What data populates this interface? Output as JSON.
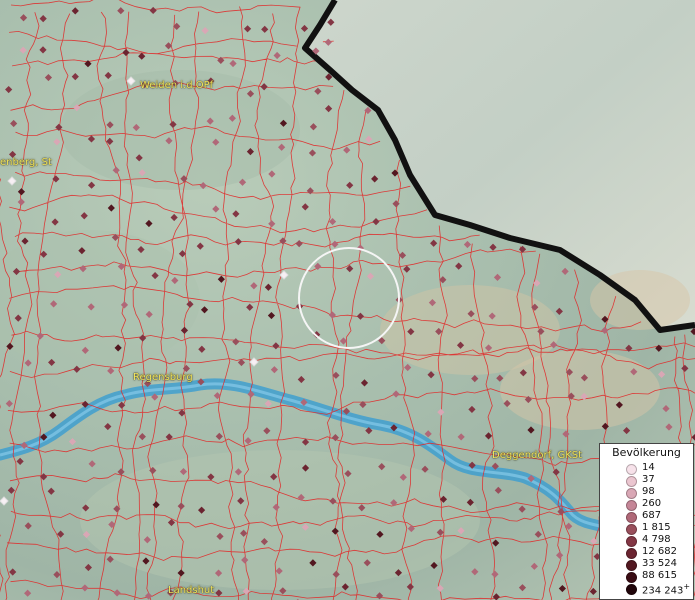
{
  "cities": [
    {
      "name": "Weiden i.d.OPf"
    },
    {
      "name": "enberg, St"
    },
    {
      "name": "Regensburg"
    },
    {
      "name": "Deggendorf, GKSt"
    },
    {
      "name": "Landshut"
    }
  ],
  "legend": {
    "title": "Bevölkerung",
    "items": [
      {
        "value": "14",
        "color": "#f7e2ea"
      },
      {
        "value": "37",
        "color": "#ebc6d0"
      },
      {
        "value": "98",
        "color": "#d9a7b5"
      },
      {
        "value": "260",
        "color": "#c58697"
      },
      {
        "value": "687",
        "color": "#b06878"
      },
      {
        "value": "1 815",
        "color": "#994f5c"
      },
      {
        "value": "4 798",
        "color": "#833644"
      },
      {
        "value": "12 682",
        "color": "#6b2430"
      },
      {
        "value": "33 524",
        "color": "#521720"
      },
      {
        "value": "88 615",
        "color": "#3a0c14"
      },
      {
        "value": "234 243",
        "color": "#21050a"
      }
    ],
    "plus": "+"
  },
  "colors": {
    "border": "#e02a2a",
    "river": "#3f9fcf",
    "state_border": "#111111",
    "city_label": "#f1e45b"
  }
}
